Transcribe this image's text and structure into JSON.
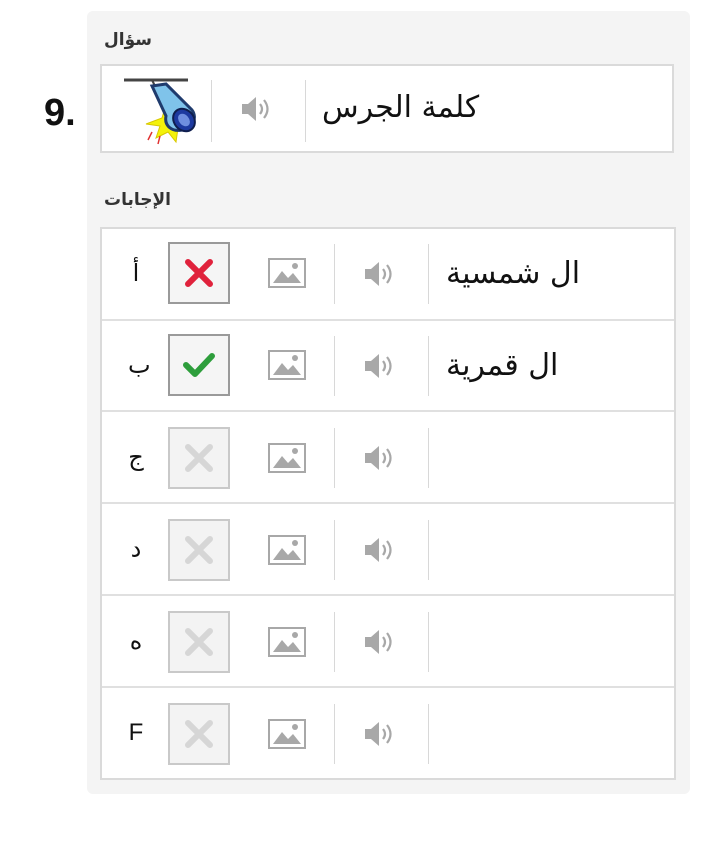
{
  "question": {
    "number": "9.",
    "section_label": "سؤال",
    "text": "كلمة الجرس",
    "image_icon": "bell-clipart",
    "audio_icon": "speaker-icon"
  },
  "answers": {
    "section_label": "الإجابات",
    "items": [
      {
        "letter": "أ",
        "text": "ال شمسية",
        "state": "incorrect",
        "state_color": "#e0223c"
      },
      {
        "letter": "ب",
        "text": "ال قمرية",
        "state": "correct",
        "state_color": "#2e9e3c"
      },
      {
        "letter": "ج",
        "text": "",
        "state": "empty"
      },
      {
        "letter": "د",
        "text": "",
        "state": "empty"
      },
      {
        "letter": "ه",
        "text": "",
        "state": "empty"
      },
      {
        "letter": "F",
        "text": "",
        "state": "empty"
      }
    ]
  },
  "colors": {
    "panel_bg": "#f4f4f4",
    "icon_gray": "#aaaaaa",
    "placeholder_x": "#d6d6d6"
  }
}
